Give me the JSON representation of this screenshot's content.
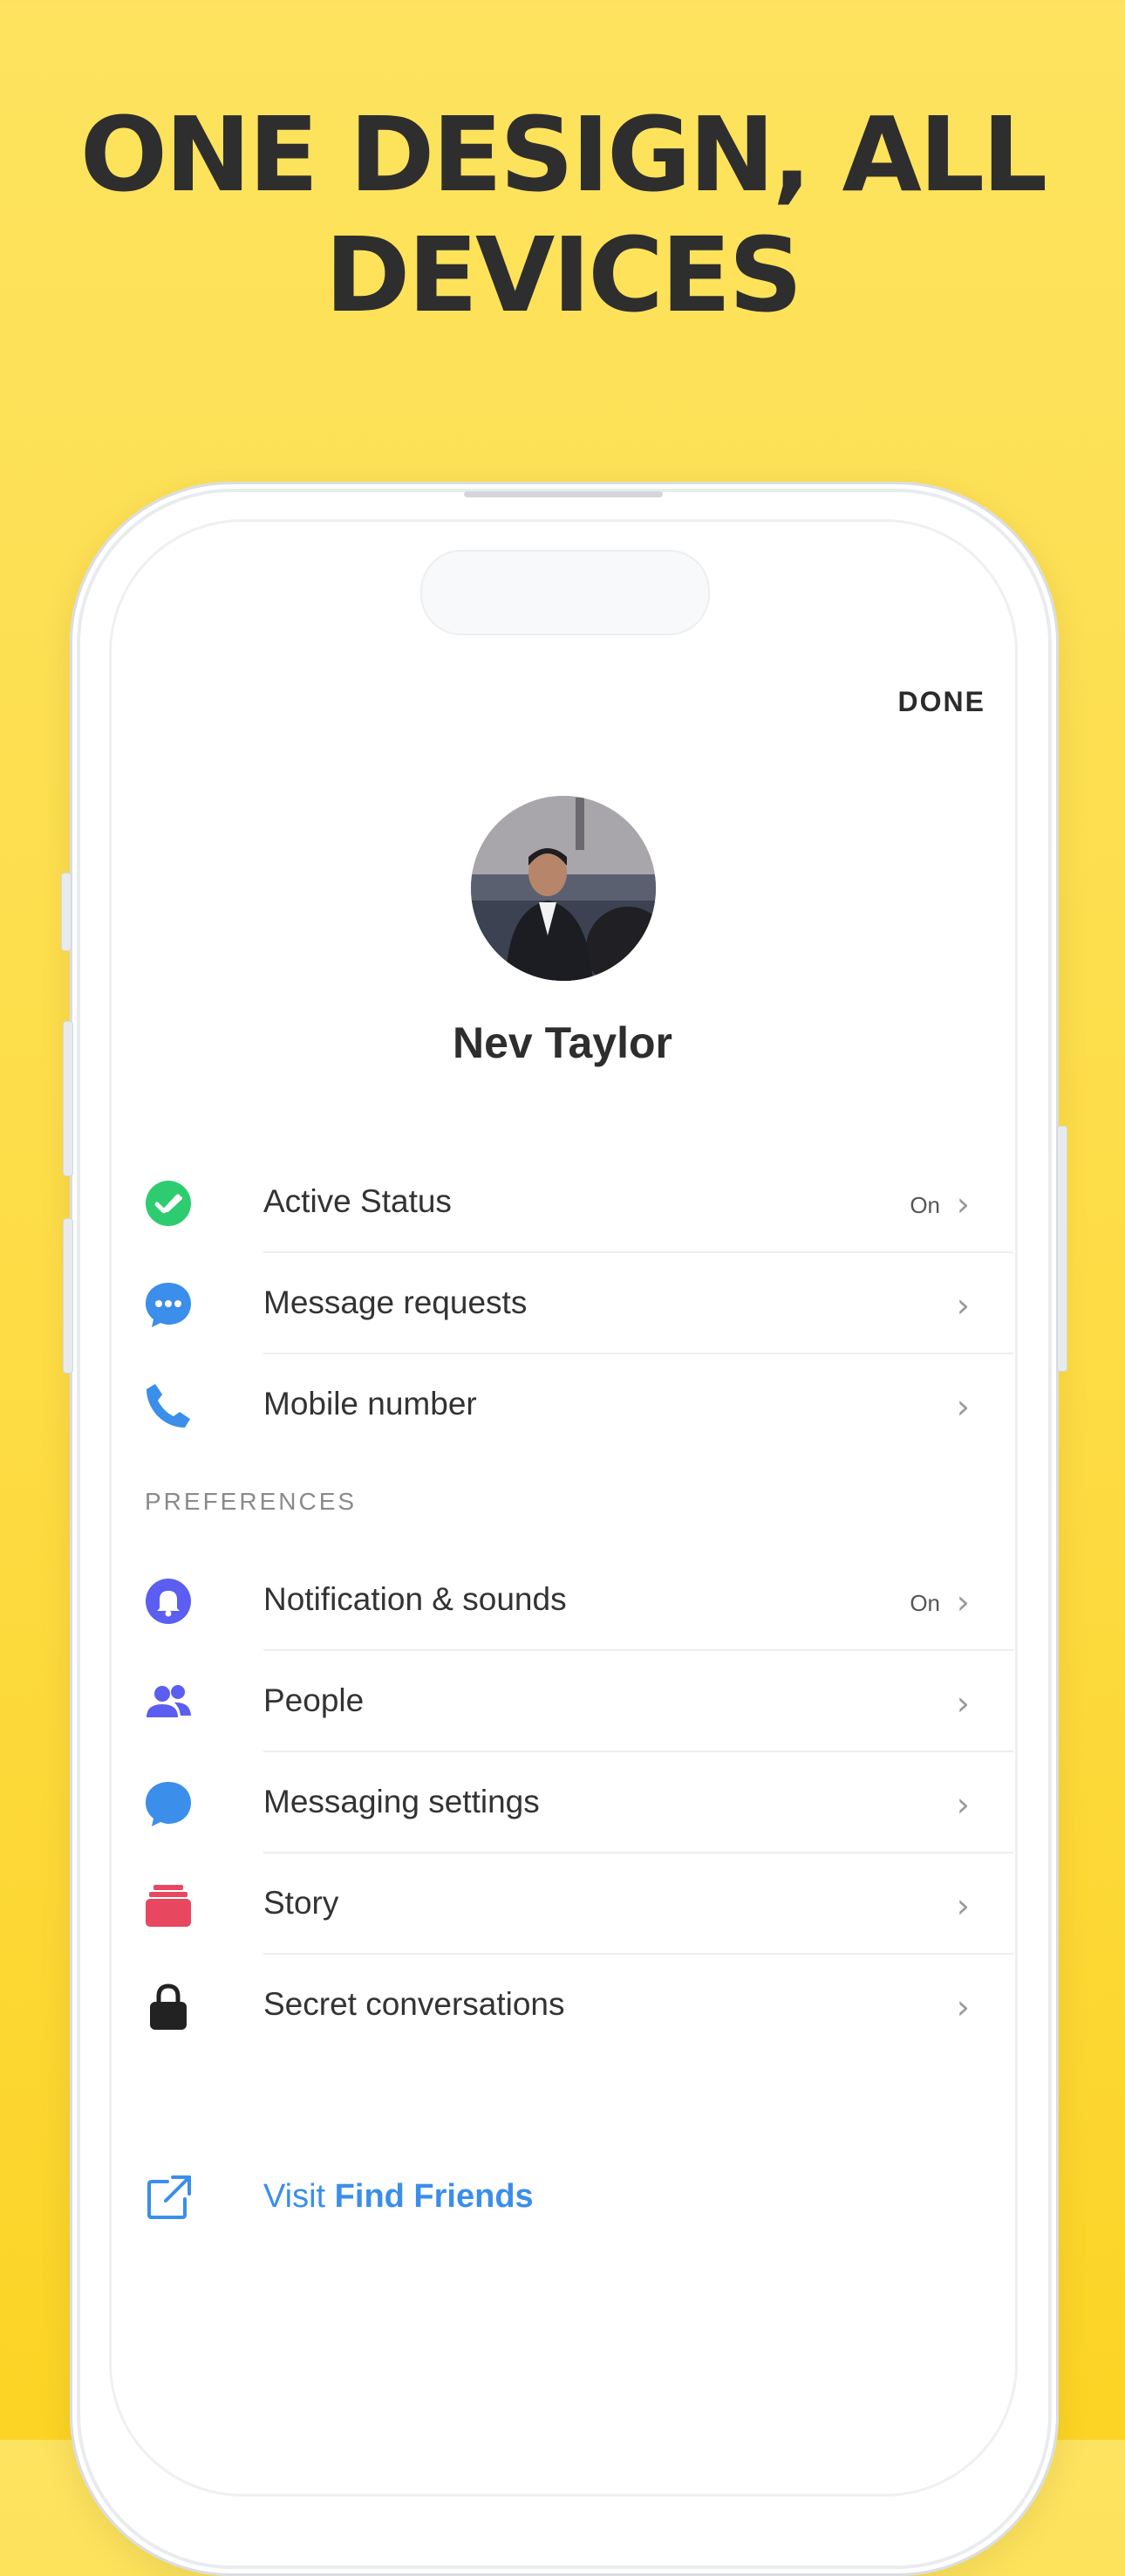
{
  "headline": {
    "line1": "ONE DESIGN, ALL",
    "line2": "DEVICES"
  },
  "header": {
    "done_label": "DONE"
  },
  "profile": {
    "name": "Nev Taylor"
  },
  "account_items": [
    {
      "label": "Active Status",
      "value": "On",
      "icon": "check-circle-icon",
      "color": "#2ecc71"
    },
    {
      "label": "Message requests",
      "value": "",
      "icon": "chat-bubble-dots-icon",
      "color": "#3b8eea"
    },
    {
      "label": "Mobile number",
      "value": "",
      "icon": "phone-icon",
      "color": "#3b8eea"
    }
  ],
  "preferences": {
    "section_title": "PREFERENCES",
    "items": [
      {
        "label": "Notification & sounds",
        "value": "On",
        "icon": "bell-icon",
        "color": "#5b5ef0"
      },
      {
        "label": "People",
        "value": "",
        "icon": "people-icon",
        "color": "#5b5ef0"
      },
      {
        "label": "Messaging settings",
        "value": "",
        "icon": "chat-bubble-icon",
        "color": "#3b8eea"
      },
      {
        "label": "Story",
        "value": "",
        "icon": "stack-icon",
        "color": "#e8485f"
      },
      {
        "label": "Secret conversations",
        "value": "",
        "icon": "lock-icon",
        "color": "#222222"
      }
    ]
  },
  "visit": {
    "prefix": "Visit ",
    "link": "Find Friends",
    "icon": "external-link-icon",
    "color": "#3b8eea"
  }
}
